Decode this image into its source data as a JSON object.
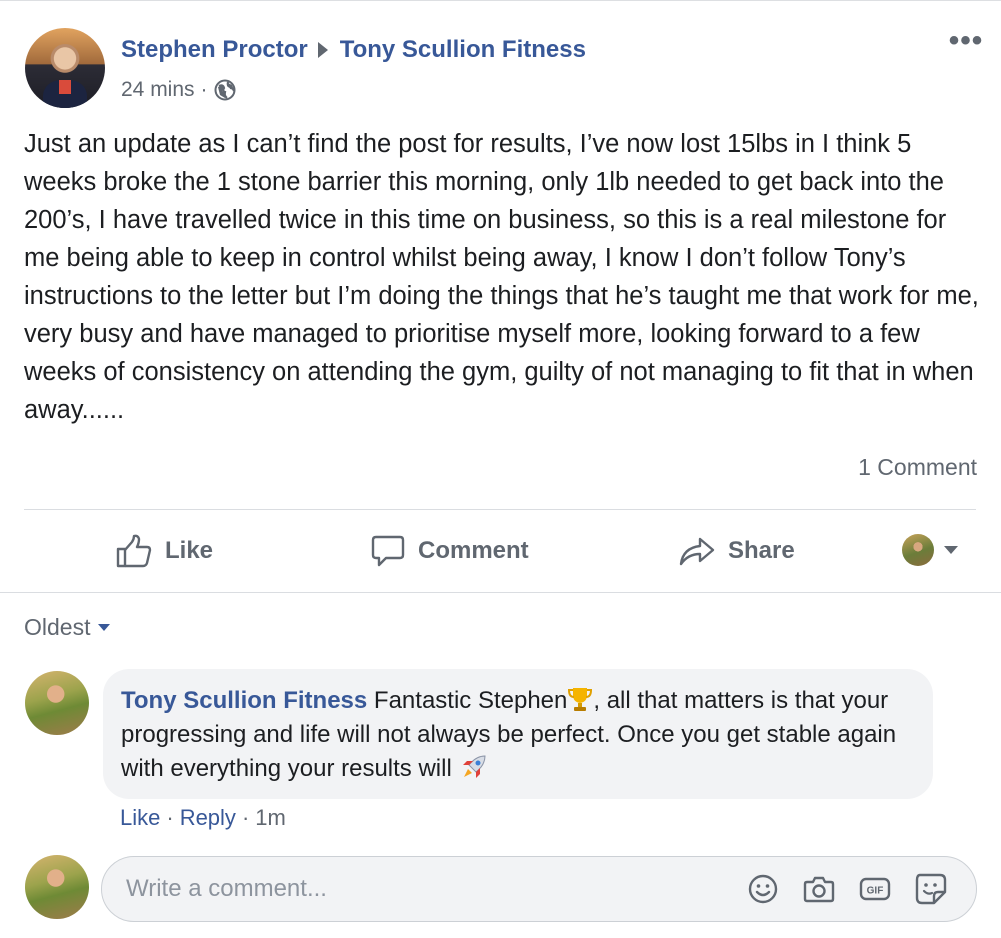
{
  "post": {
    "author": "Stephen Proctor",
    "target": "Tony Scullion Fitness",
    "time": "24 mins",
    "time_separator": "·",
    "more": "•••",
    "text": "Just an update as I can’t find the post for results, I’ve now lost 15lbs in I think 5 weeks broke the 1 stone barrier this morning, only 1lb needed to get back into the 200’s, I have travelled twice in this time on business, so this is a real milestone for me being able to keep in control whilst being away, I know I don’t follow Tony’s instructions to the letter but I’m doing the things that he’s taught me that work for me, very busy and have managed to prioritise myself more, looking forward to a few weeks of consistency on attending the gym, guilty of not managing to fit that in when away......",
    "comment_count": "1 Comment"
  },
  "actions": {
    "like": "Like",
    "comment": "Comment",
    "share": "Share"
  },
  "sort": {
    "label": "Oldest"
  },
  "comment": {
    "author": "Tony Scullion Fitness",
    "text_part1": " Fantastic Stephen",
    "text_part2": ", all that matters is that your progressing and life will not always be perfect. Once you get stable again with everything your results will ",
    "like": "Like",
    "reply": "Reply",
    "time": "1m",
    "sep": "·"
  },
  "composer": {
    "placeholder": "Write a comment..."
  },
  "colors": {
    "link_blue": "#385898",
    "secondary_text": "#606770",
    "bubble_bg": "#f2f3f5"
  },
  "icons": [
    "globe-icon",
    "like-thumb-icon",
    "comment-bubble-icon",
    "share-arrow-icon",
    "trophy-icon",
    "rocket-icon",
    "emoji-icon",
    "camera-icon",
    "gif-icon",
    "sticker-icon"
  ]
}
